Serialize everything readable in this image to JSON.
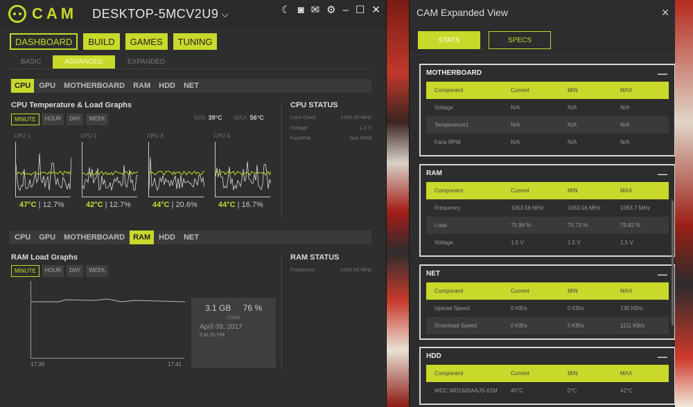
{
  "main": {
    "brand": "CAM",
    "machine_name": "DESKTOP-5MCV2U9",
    "title_icons": [
      "moon-icon",
      "camera-icon",
      "mail-icon",
      "gear-icon",
      "minimize-icon",
      "maximize-icon",
      "close-icon"
    ],
    "nav": [
      "DASHBOARD",
      "BUILD",
      "GAMES",
      "TUNING"
    ],
    "subtabs": [
      "BASIC",
      "ADVANCED",
      "EXPANDED"
    ],
    "component_tabs": [
      "CPU",
      "GPU",
      "MOTHERBOARD",
      "RAM",
      "HDD",
      "NET"
    ],
    "ranges": [
      "MINUTE",
      "HOUR",
      "DAY",
      "WEEK"
    ],
    "cpu": {
      "section_title": "CPU Temperature & Load Graphs",
      "min_label": "MIN",
      "min_value": "39°C",
      "max_label": "MAX",
      "max_value": "56°C",
      "cores": [
        {
          "label": "CPU 1",
          "temp": "47°C",
          "load": "12.7%"
        },
        {
          "label": "CPU 2",
          "temp": "42°C",
          "load": "12.7%"
        },
        {
          "label": "CPU 3",
          "temp": "44°C",
          "load": "20.6%"
        },
        {
          "label": "CPU 4",
          "temp": "44°C",
          "load": "16.7%"
        }
      ],
      "status_title": "CPU STATUS",
      "status": [
        {
          "k": "Core Clock",
          "v": "1595.33 MHz"
        },
        {
          "k": "Voltage",
          "v": "1.2 V"
        },
        {
          "k": "FanRPM",
          "v": "N/A RPM"
        }
      ]
    },
    "ram": {
      "section_title": "RAM Load Graphs",
      "status_title": "RAM STATUS",
      "status": [
        {
          "k": "Frequency",
          "v": "1063.56 MHz"
        }
      ],
      "used": "3.1 GB",
      "percent": "76 %",
      "load_label": "LOAD",
      "date": "April 09, 2017",
      "time": "5:41:51 PM",
      "t_start": "17:39",
      "t_end": "17:41"
    }
  },
  "expanded": {
    "title": "CAM Expanded View",
    "tabs": [
      "STATS",
      "SPECS"
    ],
    "headers": [
      "Component",
      "Current",
      "MIN",
      "MAX"
    ],
    "panels": [
      {
        "name": "MOTHERBOARD",
        "rows": [
          [
            "Voltage",
            "N/A",
            "N/A",
            "N/A"
          ],
          [
            "Temperature1",
            "N/A",
            "N/A",
            "N/A"
          ],
          [
            "Fans RPM",
            "N/A",
            "N/A",
            "N/A"
          ]
        ]
      },
      {
        "name": "RAM",
        "rows": [
          [
            "Frequency",
            "1063.56 MHz",
            "1063.56 MHz",
            "1063.7 MHz"
          ],
          [
            "Load",
            "75.96 %",
            "75.73 %",
            "79.82 %"
          ],
          [
            "Voltage",
            "1.5 V",
            "1.5 V",
            "1.5 V"
          ]
        ]
      },
      {
        "name": "NET",
        "rows": [
          [
            "Upload Speed",
            "0 KB/s",
            "0 KB/s",
            "136 KB/s"
          ],
          [
            "Download Speed",
            "0 KB/s",
            "0 KB/s",
            "1111 KB/s"
          ]
        ]
      },
      {
        "name": "HDD",
        "rows": [
          [
            "WDC WD1600AAJS-61M",
            "40°C",
            "0°C",
            "42°C"
          ]
        ]
      }
    ]
  },
  "colors": {
    "accent": "#c8d92b",
    "bg": "#2e2e2e"
  }
}
